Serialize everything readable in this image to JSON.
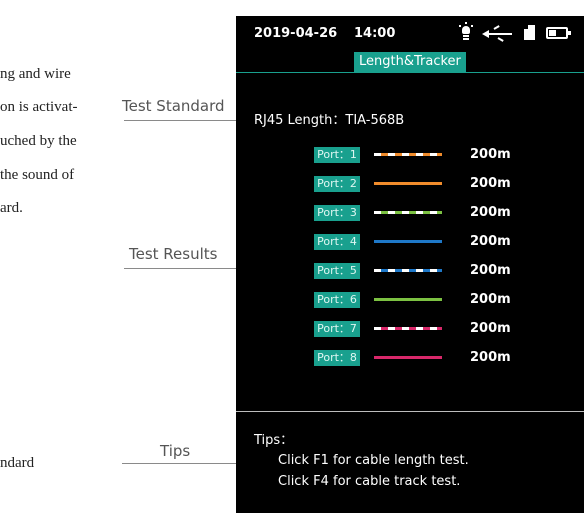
{
  "manual": {
    "lines": [
      "ng and wire",
      "on is activat-",
      "uched by the",
      "the sound of",
      "ard.",
      "ndard"
    ]
  },
  "callouts": {
    "test_standard": "Test Standard",
    "test_results": "Test Results",
    "tips": "Tips"
  },
  "status_bar": {
    "date": "2019-04-26",
    "time": "14:00",
    "icons": [
      "flashlight-icon",
      "usb-icon",
      "sd-card-icon",
      "battery-icon"
    ]
  },
  "mode_label": "Length&Tracker",
  "standard": {
    "text": "RJ45 Length：TIA-568B"
  },
  "ports": [
    {
      "label": "Port：1",
      "length": "200m",
      "wire": "white-orange",
      "stripe": "#ffffff",
      "color": "#f08c2c"
    },
    {
      "label": "Port：2",
      "length": "200m",
      "wire": "orange",
      "stripe": null,
      "color": "#f08c2c"
    },
    {
      "label": "Port：3",
      "length": "200m",
      "wire": "white-green",
      "stripe": "#ffffff",
      "color": "#7cc142"
    },
    {
      "label": "Port：4",
      "length": "200m",
      "wire": "blue",
      "stripe": null,
      "color": "#1e78c8"
    },
    {
      "label": "Port：5",
      "length": "200m",
      "wire": "white-blue",
      "stripe": "#ffffff",
      "color": "#1e78c8"
    },
    {
      "label": "Port：6",
      "length": "200m",
      "wire": "green",
      "stripe": null,
      "color": "#7cc142"
    },
    {
      "label": "Port：7",
      "length": "200m",
      "wire": "white-brown",
      "stripe": "#ffffff",
      "color": "#d8286a"
    },
    {
      "label": "Port：8",
      "length": "200m",
      "wire": "brown",
      "stripe": null,
      "color": "#d8286a"
    }
  ],
  "tips": {
    "title": "Tips：",
    "lines": [
      "Click F1 for cable length test.",
      "Click F4 for cable track test."
    ]
  },
  "colors": {
    "accent": "#19a08e",
    "screen_bg": "#000000"
  }
}
